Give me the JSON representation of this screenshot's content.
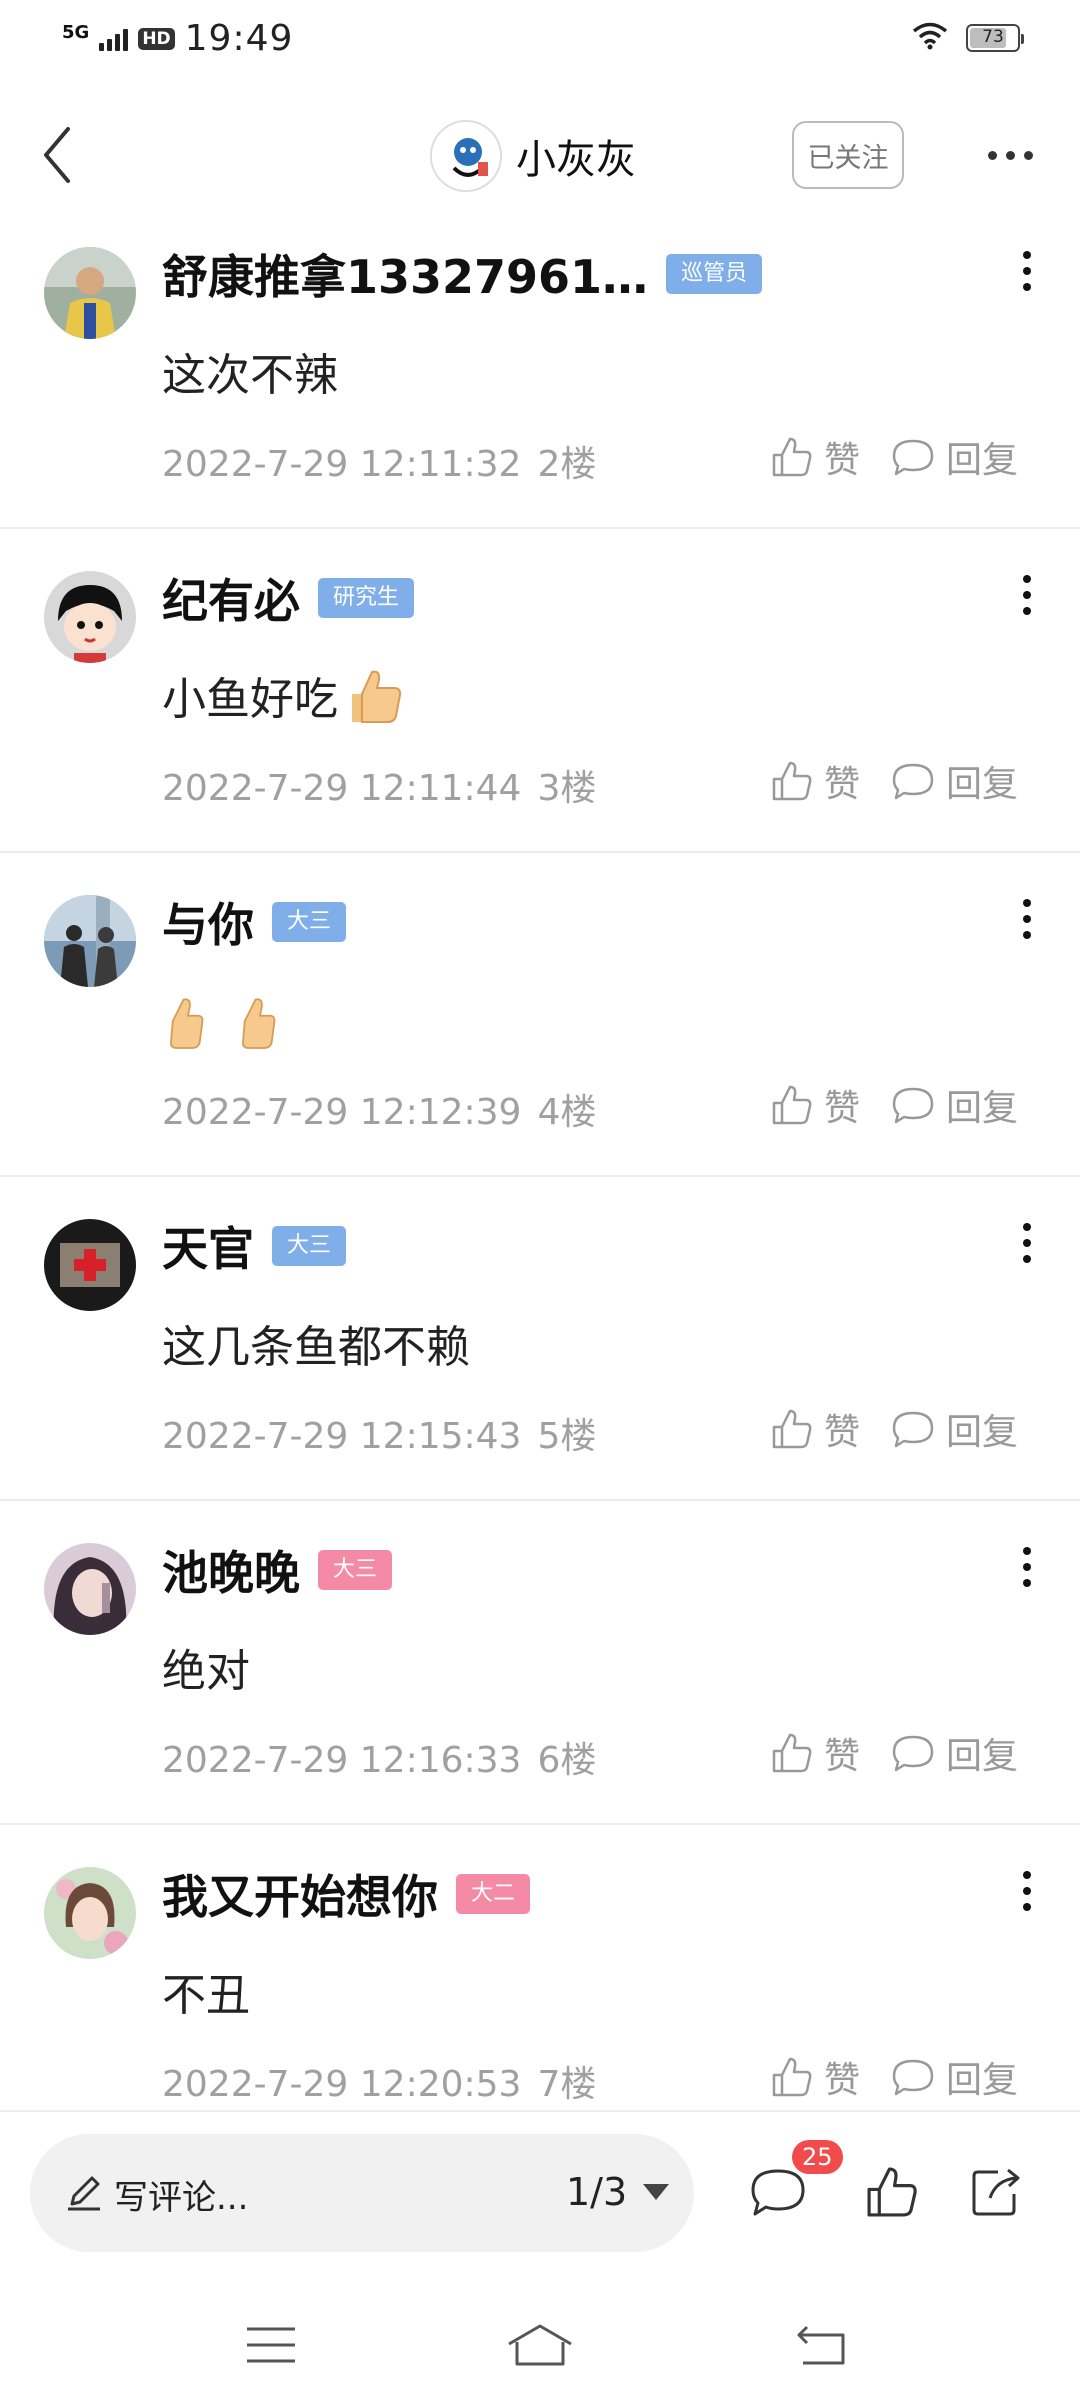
{
  "status_bar": {
    "network": "5G",
    "hd": "HD",
    "time": "19:49",
    "battery": "73"
  },
  "header": {
    "title": "小灰灰",
    "follow_label": "已关注"
  },
  "comments": [
    {
      "user": "舒康推拿13327961…",
      "badge": "巡管员",
      "badge_color": "#7faee8",
      "text": "这次不辣",
      "emojis": 0,
      "date": "2022-7-29 12:11:32",
      "floor": "2楼",
      "like_label": "赞",
      "reply_label": "回复"
    },
    {
      "user": "纪有必",
      "badge": "研究生",
      "badge_color": "#7faee8",
      "text": "小鱼好吃",
      "emojis": 1,
      "date": "2022-7-29 12:11:44",
      "floor": "3楼",
      "like_label": "赞",
      "reply_label": "回复"
    },
    {
      "user": "与你",
      "badge": "大三",
      "badge_color": "#7faee8",
      "text": "",
      "emojis": 2,
      "date": "2022-7-29 12:12:39",
      "floor": "4楼",
      "like_label": "赞",
      "reply_label": "回复"
    },
    {
      "user": "天官",
      "badge": "大三",
      "badge_color": "#7faee8",
      "text": "这几条鱼都不赖",
      "emojis": 0,
      "date": "2022-7-29 12:15:43",
      "floor": "5楼",
      "like_label": "赞",
      "reply_label": "回复"
    },
    {
      "user": "池晚晚",
      "badge": "大三",
      "badge_color": "#f48aa6",
      "text": "绝对",
      "emojis": 0,
      "date": "2022-7-29 12:16:33",
      "floor": "6楼",
      "like_label": "赞",
      "reply_label": "回复"
    },
    {
      "user": "我又开始想你",
      "badge": "大二",
      "badge_color": "#f48aa6",
      "text": "不丑",
      "emojis": 0,
      "date": "2022-7-29 12:20:53",
      "floor": "7楼",
      "like_label": "赞",
      "reply_label": "回复"
    }
  ],
  "bottom_bar": {
    "input_placeholder": "写评论...",
    "page_indicator": "1/3",
    "comment_count": "25"
  },
  "icons": [
    "back-arrow-icon",
    "more-dots-icon",
    "thumbs-up-icon",
    "speech-bubble-icon",
    "pen-icon",
    "share-icon",
    "menu-icon",
    "home-icon",
    "return-icon"
  ]
}
